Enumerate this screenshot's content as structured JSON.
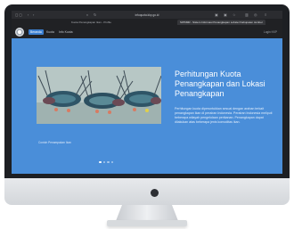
{
  "browser": {
    "url": "infoquota.kkp.go.id",
    "tabs": [
      {
        "label": "Kuota Penangkapan Ikan - Profile"
      },
      {
        "label": "SIPKMR - Sistem Informasi Penangkapan Lobster Kabupaten Jember"
      }
    ]
  },
  "nav": {
    "items": [
      {
        "label": "Beranda"
      },
      {
        "label": "Kuota"
      },
      {
        "label": "Info Kuota"
      }
    ],
    "right_label": "Login KKP"
  },
  "hero": {
    "title": "Perhitungan Kuota Penangkapan dan Lokasi Penangkapan",
    "description": "Perhitungan kuota diperuntukkan sesuai dengan arahan terkait penangkapan ikan di perairan Indonesia. Perairan Indonesia meliputi beberapa wilayah pengelolaan perikanan. Penangkapan dapat dilakukan atas beberapa jenis komoditas ikan.",
    "caption": "Contoh Penampakan Ikan",
    "slides": 4,
    "active_slide": 1
  },
  "colors": {
    "screen_bg": "#4a8ed9",
    "navbar_bg": "#202124",
    "accent": "#3c7fd0"
  }
}
